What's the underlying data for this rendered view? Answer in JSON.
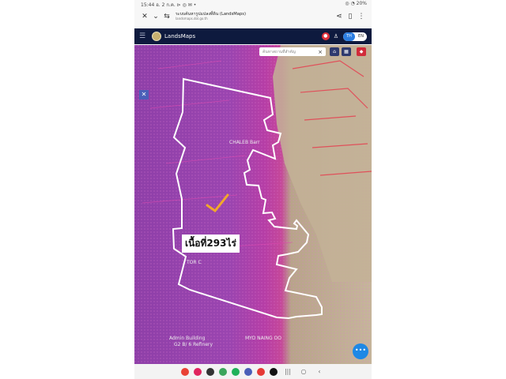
{
  "status_bar": {
    "left": "15:44  อ. 2 ก.ค.  ⊳ ◎ ✉ •",
    "right": "◎ ◔ 20%"
  },
  "browser": {
    "page_title": "ระบบค้นหารูปแปลงที่ดิน (LandsMaps)",
    "url": "landsmaps.dol.go.th",
    "close_icon": "close-icon",
    "share_icon": "share-icon",
    "bookmark_icon": "bookmark-icon",
    "menu_icon": "more-vert-icon"
  },
  "app": {
    "name": "LandsMaps",
    "lang_active": "TH",
    "lang_inactive": "EN"
  },
  "map": {
    "search_placeholder": "ค้นหาสถานที่สำคัญ",
    "search_clear": "×",
    "area_label": "เนื้อที่293ไร่",
    "labels": {
      "chaleb": "CHALEB Barr",
      "tor": "TOR C",
      "building": "Admin Building",
      "refinery": "G2 B/ 6 Refinery",
      "company": "MYO NAING OO"
    },
    "fab_label": "•••"
  }
}
